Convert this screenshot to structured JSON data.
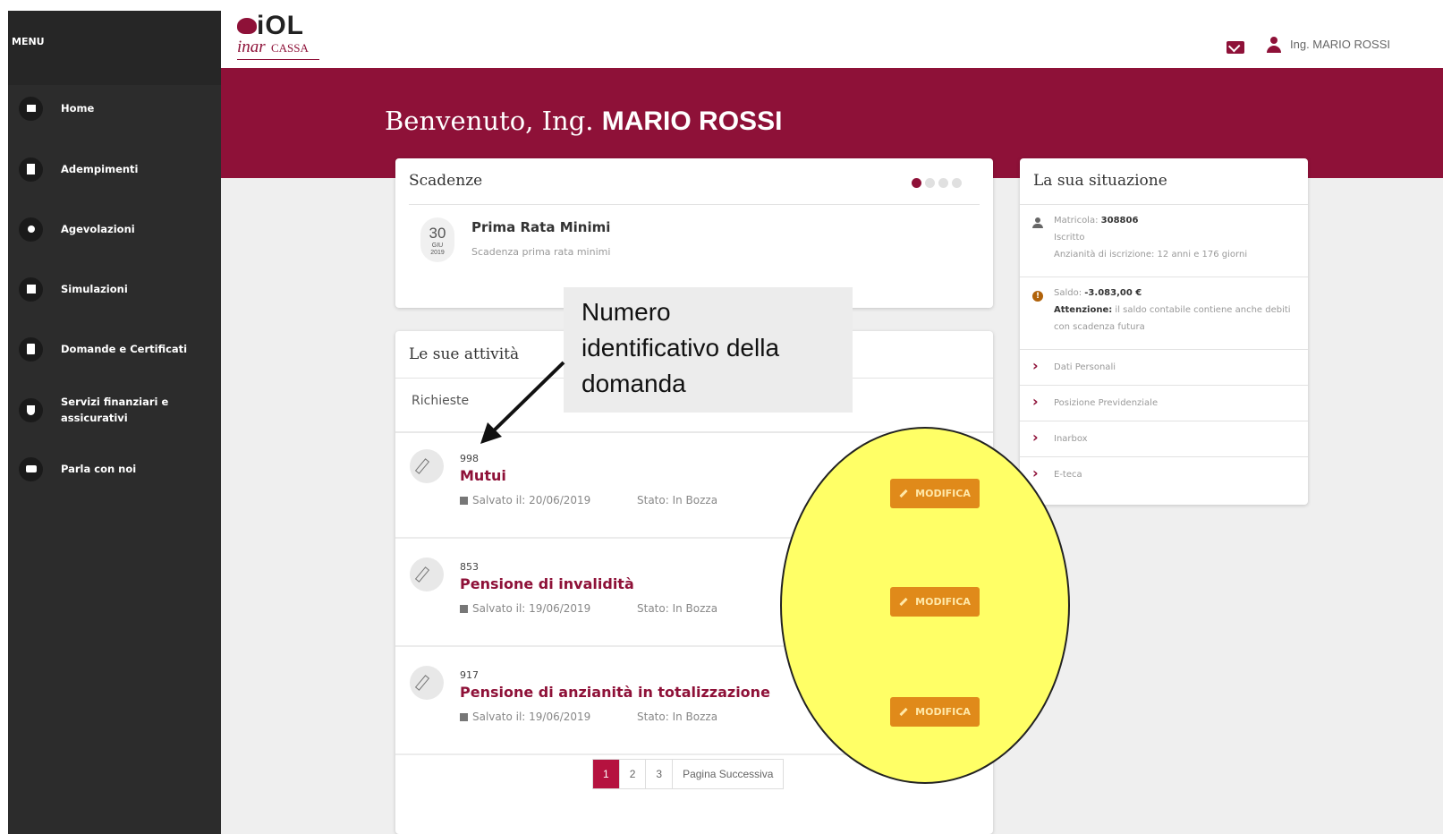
{
  "sidebar": {
    "menu_label": "MENU",
    "items": [
      {
        "label": "Home",
        "icon": "home-icon"
      },
      {
        "label": "Adempimenti",
        "icon": "clipboard-icon"
      },
      {
        "label": "Agevolazioni",
        "icon": "badge-icon"
      },
      {
        "label": "Simulazioni",
        "icon": "chip-icon"
      },
      {
        "label": "Domande e Certificati",
        "icon": "document-icon"
      },
      {
        "label": "Servizi finanziari e assicurativi",
        "icon": "shield-icon"
      },
      {
        "label": "Parla con noi",
        "icon": "chat-icon"
      }
    ]
  },
  "header": {
    "logo_iol": "iOL",
    "logo_inar": "inar",
    "logo_cassa": "CASSA",
    "user_name": "Ing. MARIO ROSSI"
  },
  "welcome": {
    "prefix": "Benvenuto, Ing.",
    "name": "MARIO ROSSI"
  },
  "scadenze": {
    "title": "Scadenze",
    "day": "30",
    "month": "GIU",
    "year": "2019",
    "item_title": "Prima Rata Minimi",
    "item_sub": "Scadenza prima rata minimi"
  },
  "attivita": {
    "title": "Le sue attività",
    "requests_label": "Richieste",
    "rows": [
      {
        "num": "998",
        "title": "Mutui",
        "date": "Salvato il: 20/06/2019",
        "state": "Stato: In Bozza"
      },
      {
        "num": "853",
        "title": "Pensione di invalidità",
        "date": "Salvato il: 19/06/2019",
        "state": "Stato: In Bozza"
      },
      {
        "num": "917",
        "title": "Pensione di anzianità in totalizzazione",
        "date": "Salvato il: 19/06/2019",
        "state": "Stato: In Bozza"
      }
    ],
    "pager": [
      "1",
      "2",
      "3",
      "Pagina Successiva"
    ],
    "modify_label": "MODIFICA"
  },
  "situazione": {
    "title": "La sua situazione",
    "matricola_label": "Matricola:",
    "matricola_value": "308806",
    "iscritto": "Iscritto",
    "anzianita": "Anzianità di iscrizione: 12 anni e 176 giorni",
    "saldo_label": "Saldo:",
    "saldo_value": "-3.083,00 €",
    "attenzione_label": "Attenzione:",
    "attenzione_text": "il saldo contabile contiene anche debiti con scadenza futura",
    "links": [
      "Dati Personali",
      "Posizione Previdenziale",
      "Inarbox",
      "E-teca"
    ]
  },
  "annotation": {
    "callout_line1": "Numero",
    "callout_line2": "identificativo della",
    "callout_line3": "domanda"
  },
  "colors": {
    "brand": "#8e1138",
    "sidebar": "#2c2c2c",
    "highlight": "#ffff66",
    "button": "#e08a1a"
  }
}
